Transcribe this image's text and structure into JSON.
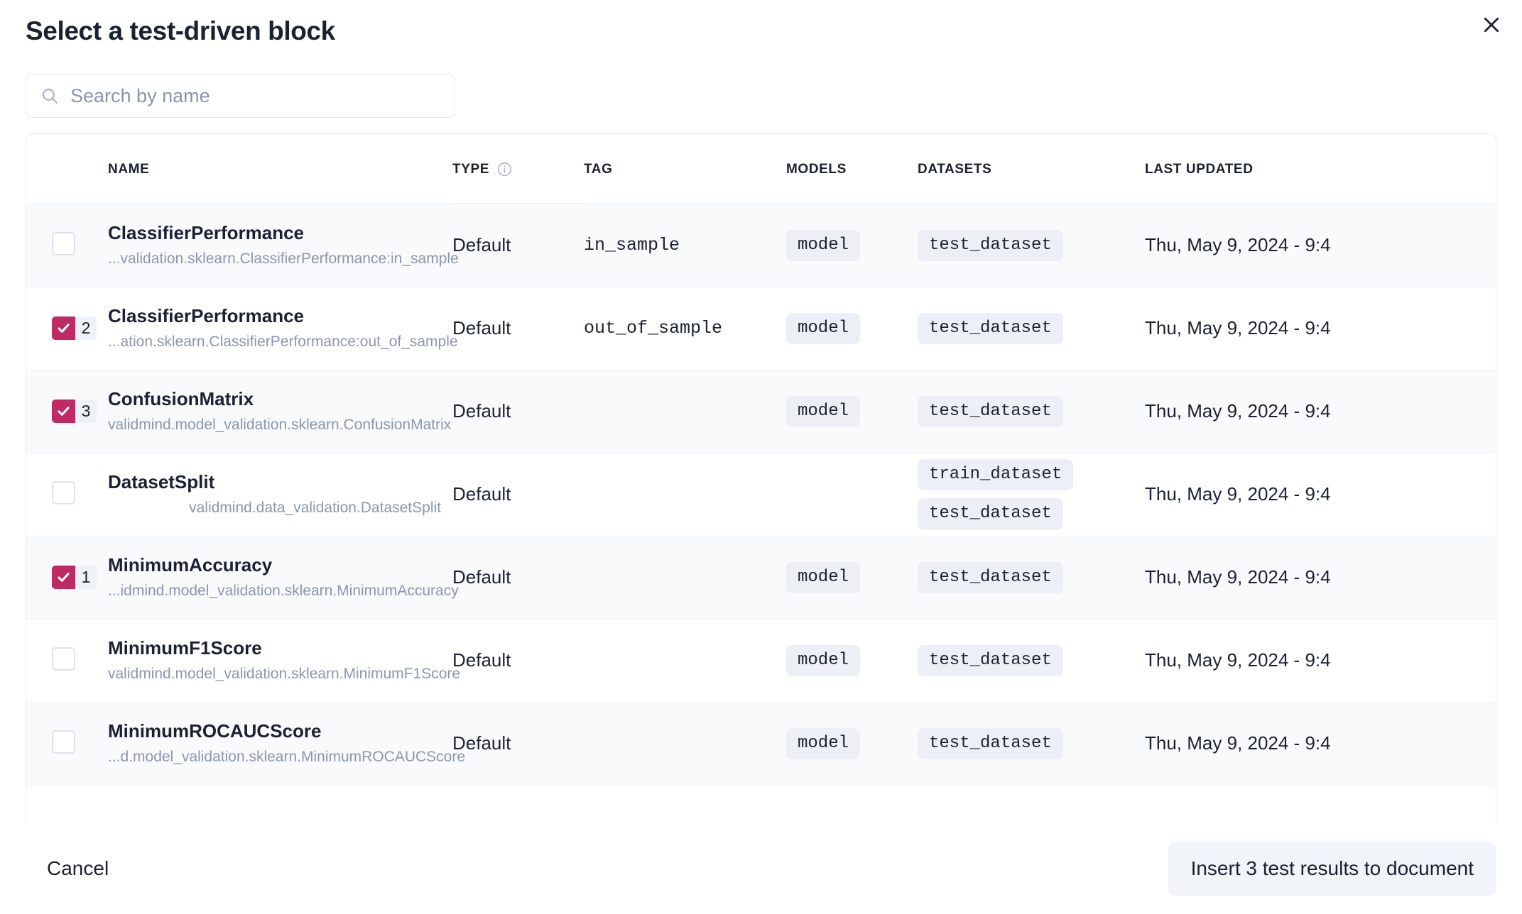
{
  "modal": {
    "title": "Select a test-driven block",
    "close_icon": "close-icon"
  },
  "search": {
    "placeholder": "Search by name",
    "value": "",
    "icon": "search-icon"
  },
  "table": {
    "columns": [
      {
        "key": "check",
        "label": ""
      },
      {
        "key": "name",
        "label": "NAME"
      },
      {
        "key": "type",
        "label": "TYPE",
        "info_icon": "info-circle-icon"
      },
      {
        "key": "tag",
        "label": "TAG"
      },
      {
        "key": "models",
        "label": "MODELS"
      },
      {
        "key": "datasets",
        "label": "DATASETS"
      },
      {
        "key": "updated",
        "label": "LAST UPDATED"
      }
    ],
    "rows": [
      {
        "checked": false,
        "order": "",
        "name": "ClassifierPerformance",
        "path": "...validation.sklearn.ClassifierPerformance:in_sample",
        "type": "Default",
        "tag": "in_sample",
        "models": [
          "model"
        ],
        "datasets": [
          "test_dataset"
        ],
        "updated": "Thu, May 9, 2024 - 9:4"
      },
      {
        "checked": true,
        "order": "2",
        "name": "ClassifierPerformance",
        "path": "...ation.sklearn.ClassifierPerformance:out_of_sample",
        "type": "Default",
        "tag": "out_of_sample",
        "models": [
          "model"
        ],
        "datasets": [
          "test_dataset"
        ],
        "updated": "Thu, May 9, 2024 - 9:4"
      },
      {
        "checked": true,
        "order": "3",
        "name": "ConfusionMatrix",
        "path": "validmind.model_validation.sklearn.ConfusionMatrix",
        "type": "Default",
        "tag": "",
        "models": [
          "model"
        ],
        "datasets": [
          "test_dataset"
        ],
        "updated": "Thu, May 9, 2024 - 9:4"
      },
      {
        "checked": false,
        "order": "",
        "name": "DatasetSplit",
        "path": "validmind.data_validation.DatasetSplit",
        "type": "Default",
        "tag": "",
        "models": [],
        "datasets": [
          "train_dataset",
          "test_dataset"
        ],
        "updated": "Thu, May 9, 2024 - 9:4"
      },
      {
        "checked": true,
        "order": "1",
        "name": "MinimumAccuracy",
        "path": "...idmind.model_validation.sklearn.MinimumAccuracy",
        "type": "Default",
        "tag": "",
        "models": [
          "model"
        ],
        "datasets": [
          "test_dataset"
        ],
        "updated": "Thu, May 9, 2024 - 9:4"
      },
      {
        "checked": false,
        "order": "",
        "name": "MinimumF1Score",
        "path": "validmind.model_validation.sklearn.MinimumF1Score",
        "type": "Default",
        "tag": "",
        "models": [
          "model"
        ],
        "datasets": [
          "test_dataset"
        ],
        "updated": "Thu, May 9, 2024 - 9:4"
      },
      {
        "checked": false,
        "order": "",
        "name": "MinimumROCAUCScore",
        "path": "...d.model_validation.sklearn.MinimumROCAUCScore",
        "type": "Default",
        "tag": "",
        "models": [
          "model"
        ],
        "datasets": [
          "test_dataset"
        ],
        "updated": "Thu, May 9, 2024 - 9:4"
      }
    ]
  },
  "footer": {
    "cancel_label": "Cancel",
    "insert_label": "Insert 3 test results to document"
  },
  "colors": {
    "accent": "#bf2a64",
    "pill_bg": "#eceff5",
    "stripe_bg": "#f8fafc",
    "border": "#e3e8ef",
    "text": "#1b2130",
    "muted_text": "#8d96ab"
  }
}
